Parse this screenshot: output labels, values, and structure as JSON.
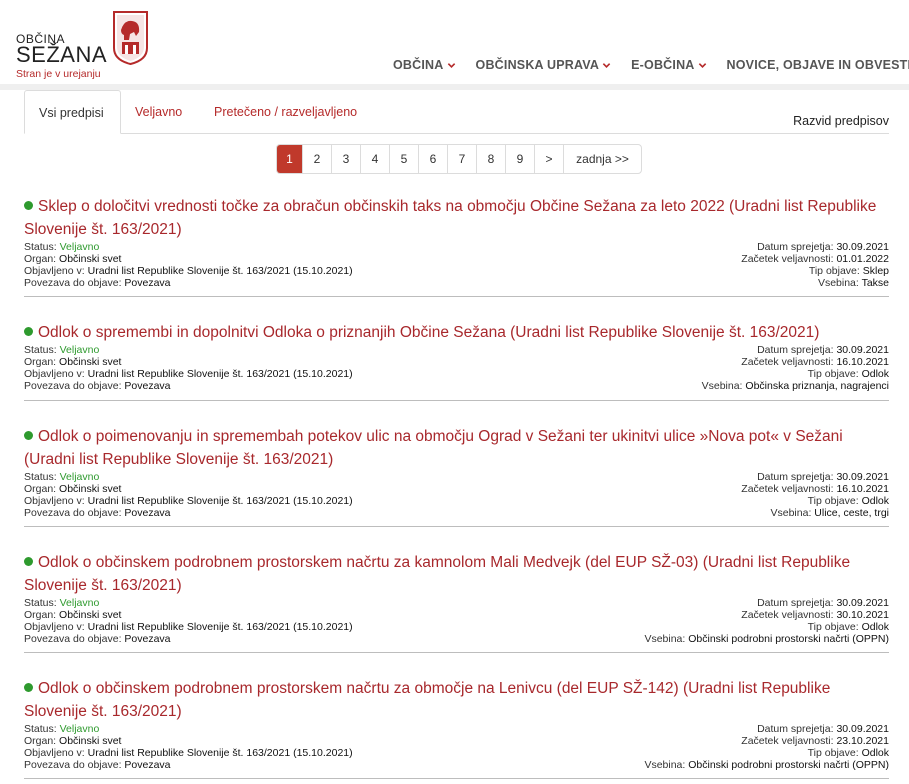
{
  "header": {
    "logo_top": "OBČINA",
    "logo_main": "SEŽANA",
    "logo_sub": "Stran je v urejanju",
    "nav": [
      {
        "label": "OBČINA"
      },
      {
        "label": "OBČINSKA UPRAVA"
      },
      {
        "label": "E-OBČINA"
      },
      {
        "label": "NOVICE, OBJAVE IN OBVESTI"
      }
    ]
  },
  "tabs": {
    "items": [
      {
        "label": "Vsi predpisi",
        "active": true
      },
      {
        "label": "Veljavno",
        "active": false
      },
      {
        "label": "Pretečeno / razveljavljeno",
        "active": false
      }
    ],
    "right_label": "Razvid predpisov"
  },
  "pagination": {
    "pages": [
      "1",
      "2",
      "3",
      "4",
      "5",
      "6",
      "7",
      "8",
      "9",
      ">",
      "zadnja >>"
    ],
    "active": "1"
  },
  "labels": {
    "status": "Status:",
    "organ": "Organ:",
    "objavljeno": "Objavljeno v:",
    "povezava": "Povezava do objave:",
    "datum": "Datum sprejetja:",
    "zacetek": "Začetek veljavnosti:",
    "tip": "Tip objave:",
    "vsebina": "Vsebina:"
  },
  "entries": [
    {
      "title": "Sklep o določitvi vrednosti točke za obračun občinskih taks na območju Občine Sežana za leto 2022 (Uradni list Republike Slovenije št. 163/2021)",
      "status": "Veljavno",
      "organ": "Občinski svet",
      "objavljeno": "Uradni list Republike Slovenije št. 163/2021 (15.10.2021)",
      "povezava": "Povezava",
      "datum": "30.09.2021",
      "zacetek": "01.01.2022",
      "tip": "Sklep",
      "vsebina": "Takse"
    },
    {
      "title": "Odlok o spremembi in dopolnitvi Odloka o priznanjih Občine Sežana (Uradni list Republike Slovenije št. 163/2021)",
      "status": "Veljavno",
      "organ": "Občinski svet",
      "objavljeno": "Uradni list Republike Slovenije št. 163/2021 (15.10.2021)",
      "povezava": "Povezava",
      "datum": "30.09.2021",
      "zacetek": "16.10.2021",
      "tip": "Odlok",
      "vsebina": "Občinska priznanja, nagrajenci"
    },
    {
      "title": "Odlok o poimenovanju in spremembah potekov ulic na območju Ograd v Sežani ter ukinitvi ulice »Nova pot« v Sežani (Uradni list Republike Slovenije št. 163/2021)",
      "status": "Veljavno",
      "organ": "Občinski svet",
      "objavljeno": "Uradni list Republike Slovenije št. 163/2021 (15.10.2021)",
      "povezava": "Povezava",
      "datum": "30.09.2021",
      "zacetek": "16.10.2021",
      "tip": "Odlok",
      "vsebina": "Ulice, ceste, trgi"
    },
    {
      "title": "Odlok o občinskem podrobnem prostorskem načrtu za kamnolom Mali Medvejk (del EUP SŽ-03) (Uradni list Republike Slovenije št. 163/2021)",
      "status": "Veljavno",
      "organ": "Občinski svet",
      "objavljeno": "Uradni list Republike Slovenije št. 163/2021 (15.10.2021)",
      "povezava": "Povezava",
      "datum": "30.09.2021",
      "zacetek": "30.10.2021",
      "tip": "Odlok",
      "vsebina": "Občinski podrobni prostorski načrti (OPPN)"
    },
    {
      "title": "Odlok o občinskem podrobnem prostorskem načrtu za območje na Lenivcu (del EUP SŽ-142) (Uradni list Republike Slovenije št. 163/2021)",
      "status": "Veljavno",
      "organ": "Občinski svet",
      "objavljeno": "Uradni list Republike Slovenije št. 163/2021 (15.10.2021)",
      "povezava": "Povezava",
      "datum": "30.09.2021",
      "zacetek": "23.10.2021",
      "tip": "Odlok",
      "vsebina": "Občinski podrobni prostorski načrti (OPPN)"
    }
  ]
}
